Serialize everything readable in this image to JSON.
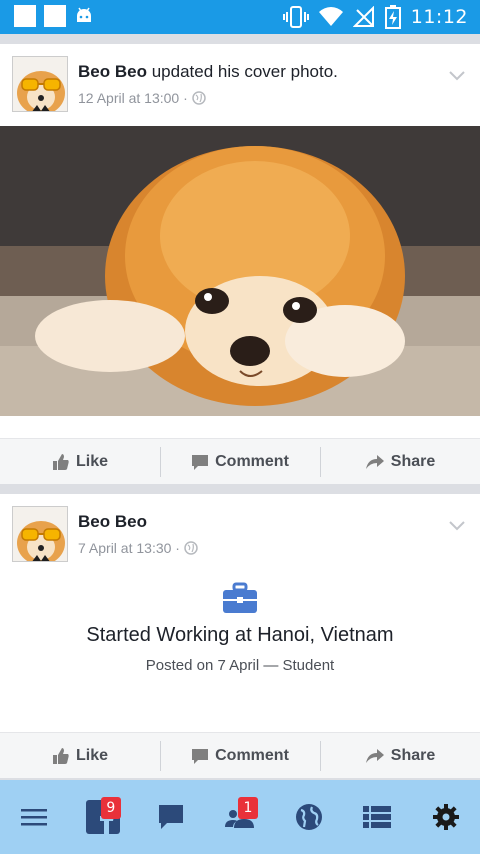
{
  "status_bar": {
    "time": "11:12"
  },
  "feed": {
    "posts": [
      {
        "author": "Beo Beo",
        "action_text": "updated his cover photo.",
        "timestamp": "12 April at 13:00 ·",
        "actions": {
          "like": "Like",
          "comment": "Comment",
          "share": "Share"
        }
      },
      {
        "author": "Beo Beo",
        "timestamp": "7 April at 13:30 ·",
        "life_event": {
          "title": "Started Working at Hanoi, Vietnam",
          "subtitle": "Posted on 7 April — Student"
        },
        "actions": {
          "like": "Like",
          "comment": "Comment",
          "share": "Share"
        }
      }
    ]
  },
  "bottom_nav": {
    "items": [
      {
        "icon": "menu-icon"
      },
      {
        "icon": "facebook-icon",
        "badge": "9"
      },
      {
        "icon": "messages-icon"
      },
      {
        "icon": "friends-icon",
        "badge": "1"
      },
      {
        "icon": "globe-icon"
      },
      {
        "icon": "list-icon"
      },
      {
        "icon": "settings-icon"
      }
    ]
  },
  "colors": {
    "status_bar": "#1a9ae6",
    "bottom_nav": "#9fd0f3",
    "accent": "#3b5998",
    "badge": "#e9313a"
  }
}
